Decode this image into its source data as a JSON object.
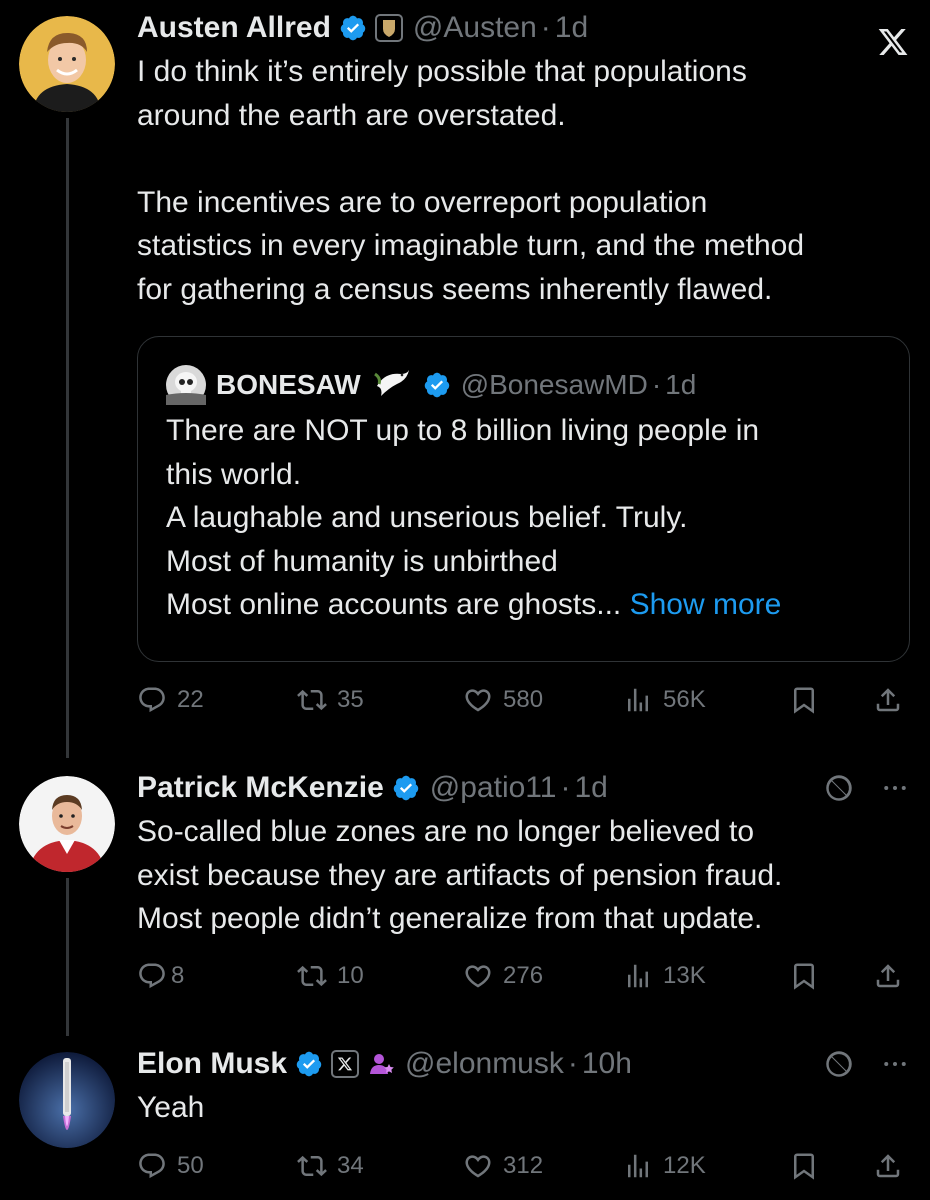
{
  "tweets": [
    {
      "name": "Austen Allred",
      "handle": "@Austen",
      "separator": "·",
      "time": "1d",
      "text": "I do think it’s entirely possible that populations\naround the earth are overstated.\n\nThe incentives are to overreport population\nstatistics in every imaginable turn, and the method\nfor gathering a census seems inherently flawed.",
      "quote": {
        "name": "BONESAW",
        "handle": "@BonesawMD",
        "separator": "·",
        "time": "1d",
        "text": "There are NOT up to 8 billion living people in\nthis world.\nA laughable and unserious belief. Truly.\nMost of humanity is unbirthed\nMost online accounts are ghosts",
        "ellipsis": "...",
        "show_more": " Show more"
      },
      "stats": {
        "replies": "22",
        "reposts": "35",
        "likes": "580",
        "views": "56K"
      }
    },
    {
      "name": "Patrick McKenzie",
      "handle": "@patio11",
      "separator": "·",
      "time": "1d",
      "text": "So-called blue zones are no longer believed to\nexist because they are artifacts of pension fraud.\nMost people didn’t generalize from that update.",
      "stats": {
        "replies": "8",
        "reposts": "10",
        "likes": "276",
        "views": "13K"
      }
    },
    {
      "name": "Elon Musk",
      "handle": "@elonmusk",
      "separator": "·",
      "time": "10h",
      "text": "Yeah",
      "stats": {
        "replies": "50",
        "reposts": "34",
        "likes": "312",
        "views": "12K"
      }
    }
  ],
  "colors": {
    "background": "#000000",
    "text": "#e7e9ea",
    "muted": "#71767b",
    "accent": "#1d9bf0",
    "verified": "#1d9bf0"
  },
  "icons": [
    "verified-badge-icon",
    "shield-badge-icon",
    "x-logo-icon",
    "reply-icon",
    "repost-icon",
    "like-icon",
    "views-icon",
    "bookmark-icon",
    "share-icon",
    "grok-icon",
    "more-icon",
    "dove-emoji-icon",
    "skull-avatar-icon",
    "affiliate-person-icon"
  ]
}
